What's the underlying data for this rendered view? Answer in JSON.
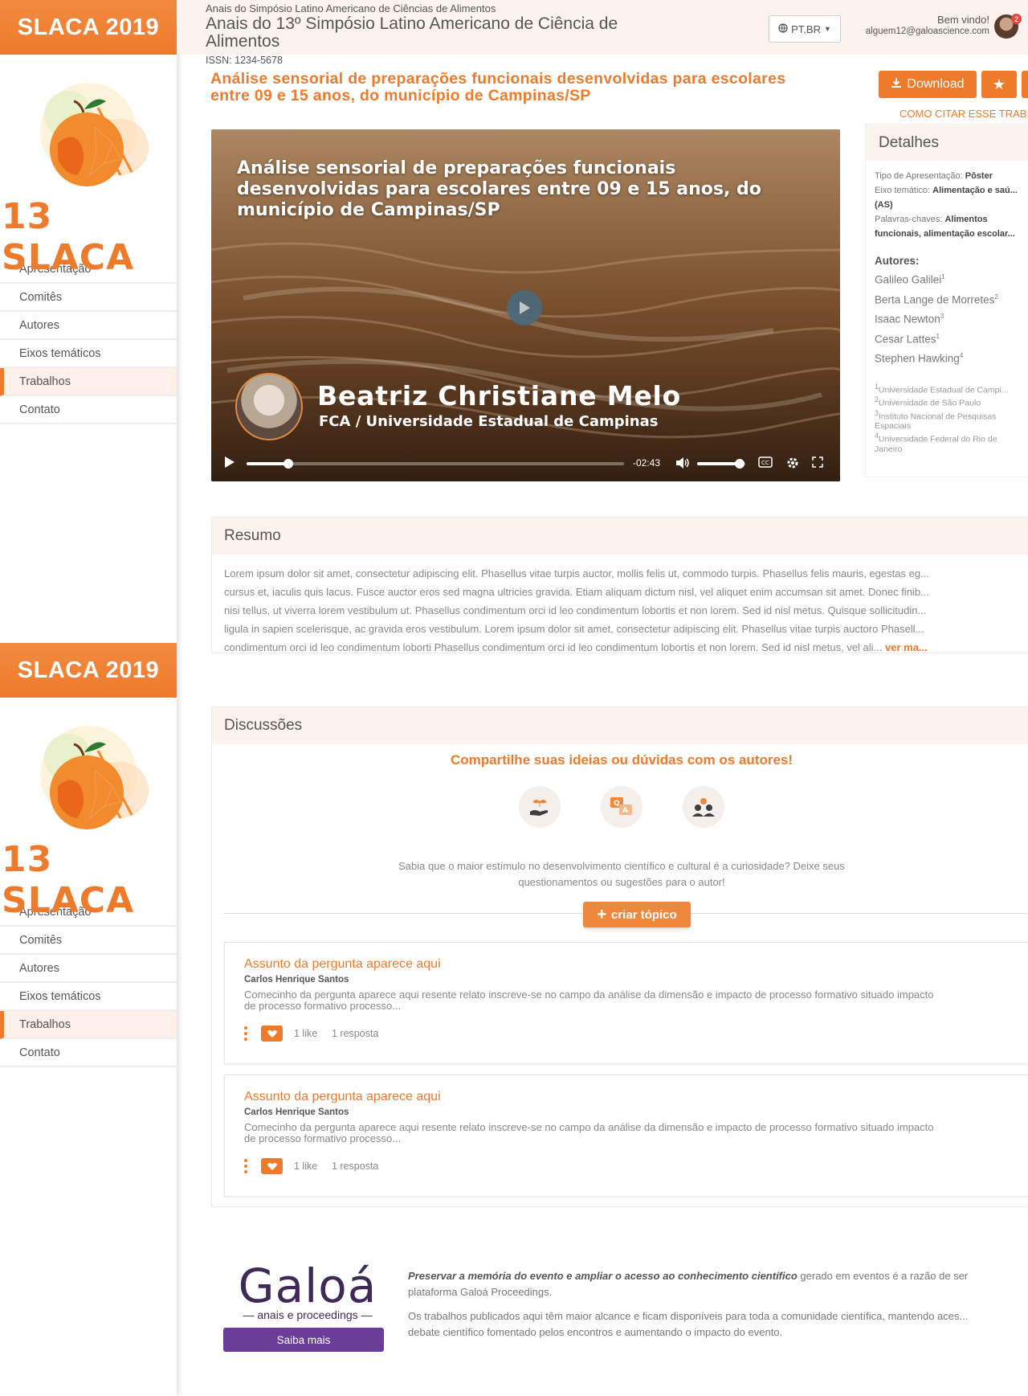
{
  "sidebar": {
    "brand": "SLACA 2019",
    "logo_text": "13 SLACA",
    "nav": [
      "Apresentação",
      "Comitês",
      "Autores",
      "Eixos temáticos",
      "Trabalhos",
      "Contato"
    ],
    "active_item": "Trabalhos"
  },
  "header": {
    "supertitle": "Anais do Simpósio Latino Americano de Ciências de Alimentos",
    "title": "Anais do 13º Simpósio Latino Americano de Ciência de Alimentos",
    "issn": "ISSN: 1234-5678",
    "language": "PT,BR",
    "welcome": "Bem vindo!",
    "email": "alguem12@galoascience.com",
    "notification_count": "2"
  },
  "article": {
    "title": "Análise sensorial de preparações funcionais desenvolvidas para escolares entre 09 e 15 anos, do município de Campinas/SP",
    "download_label": "Download",
    "cite_label": "COMO CITAR ESSE TRAB..."
  },
  "video": {
    "title": "Análise sensorial de preparações funcionais desenvolvidas para escolares entre 09 e 15 anos, do município de Campinas/SP",
    "presenter": "Beatriz Christiane Melo",
    "affiliation": "FCA / Universidade Estadual de Campinas",
    "time_remaining": "-02:43",
    "progress_fraction": 0.11,
    "volume_fraction": 0.88
  },
  "details": {
    "heading": "Detalhes",
    "type_label": "Tipo de Apresentação:",
    "type_value": "Pôster",
    "axis_label": "Eixo temático:",
    "axis_value": "Alimentação e saú...",
    "axis_value_2": "(AS)",
    "keywords_label": "Palavras-chaves:",
    "keywords_value": "Alimentos",
    "keywords_value_2": "funcionais, alimentação escolar...",
    "authors_label": "Autores:",
    "authors": [
      {
        "name": "Galileo Galilei",
        "sup": "1"
      },
      {
        "name": "Berta Lange de Morretes",
        "sup": "2"
      },
      {
        "name": "Isaac Newton",
        "sup": "3"
      },
      {
        "name": "Cesar Lattes",
        "sup": "1"
      },
      {
        "name": "Stephen Hawking",
        "sup": "4"
      }
    ],
    "institutions": [
      {
        "sup": "1",
        "name": "Universidade Estadual de Campi..."
      },
      {
        "sup": "2",
        "name": "Universidade de São Paulo"
      },
      {
        "sup": "3",
        "name": "Instituto Nacional de Pesquisas"
      },
      {
        "sup": "",
        "name": "Espaciais"
      },
      {
        "sup": "4",
        "name": "Universidade Federal do Rio de"
      },
      {
        "sup": "",
        "name": "Janeiro"
      }
    ]
  },
  "resumo": {
    "heading": "Resumo",
    "lines": [
      "Lorem ipsum dolor sit amet, consectetur adipiscing elit. Phasellus vitae turpis auctor, mollis felis ut, commodo turpis. Phasellus felis mauris, egestas eg...",
      "cursus et, iaculis quis lacus. Fusce auctor eros sed magna ultricies gravida. Etiam aliquam dictum nisl, vel aliquet enim accumsan sit amet. Donec finib...",
      "nisi tellus, ut viverra lorem vestibulum ut. Phasellus condimentum orci id leo condimentum lobortis et non lorem. Sed id nisl metus. Quisque sollicitudin...",
      "ligula in sapien scelerisque, ac gravida eros vestibulum. Lorem ipsum dolor sit amet, consectetur adipiscing elit. Phasellus vitae turpis auctoro Phasell...",
      "condimentum orci id leo condimentum loborti Phasellus condimentum orci id leo condimentum lobortis et non lorem. Sed id nisl metus, vel ali..."
    ],
    "more_label": "ver ma..."
  },
  "discussions": {
    "heading": "Discussões",
    "lead": "Compartilhe suas ideias ou dúvidas com os autores!",
    "subtext_1": "Sabia que o maior estímulo no desenvolvimento científico e cultural é a curiosidade? Deixe seus",
    "subtext_2": "questionamentos ou sugestões para o autor!",
    "create_label": "criar tópico",
    "topics": [
      {
        "title": "Assunto da pergunta aparece aqui",
        "author": "Carlos Henrique Santos",
        "text_1": "Comecinho da pergunta aparece aqui resente relato inscreve-se no campo da análise da dimensão e impacto de processo formativo situado impacto",
        "text_2": "de processo formativo processo...",
        "likes": "1 like",
        "replies": "1 resposta"
      },
      {
        "title": "Assunto da pergunta aparece aqui",
        "author": "Carlos Henrique Santos",
        "text_1": "Comecinho da pergunta aparece aqui resente relato inscreve-se no campo da análise da dimensão e impacto de processo formativo situado impacto",
        "text_2": "de processo formativo processo...",
        "likes": "1 like",
        "replies": "1 resposta"
      }
    ]
  },
  "footer": {
    "brand": "Galoá",
    "brand_sub": "— anais e proceedings —",
    "saiba_label": "Saiba mais",
    "p1_bold": "Preservar a memória do evento e ampliar o acesso ao conhecimento científico",
    "p1_rest": " gerado em eventos é a razão de ser",
    "p1_line2": "plataforma Galoá Proceedings.",
    "p2_line1": "Os trabalhos publicados aqui têm maior alcance e ficam disponíveis para toda a comunidade científica, mantendo aces...",
    "p2_line2": "debate científico fomentado pelos encontros e aumentando o impacto do evento."
  },
  "colors": {
    "accent": "#ee7a2c",
    "header_bg": "#fdf3ee",
    "galoa_purple": "#6a3e98"
  }
}
